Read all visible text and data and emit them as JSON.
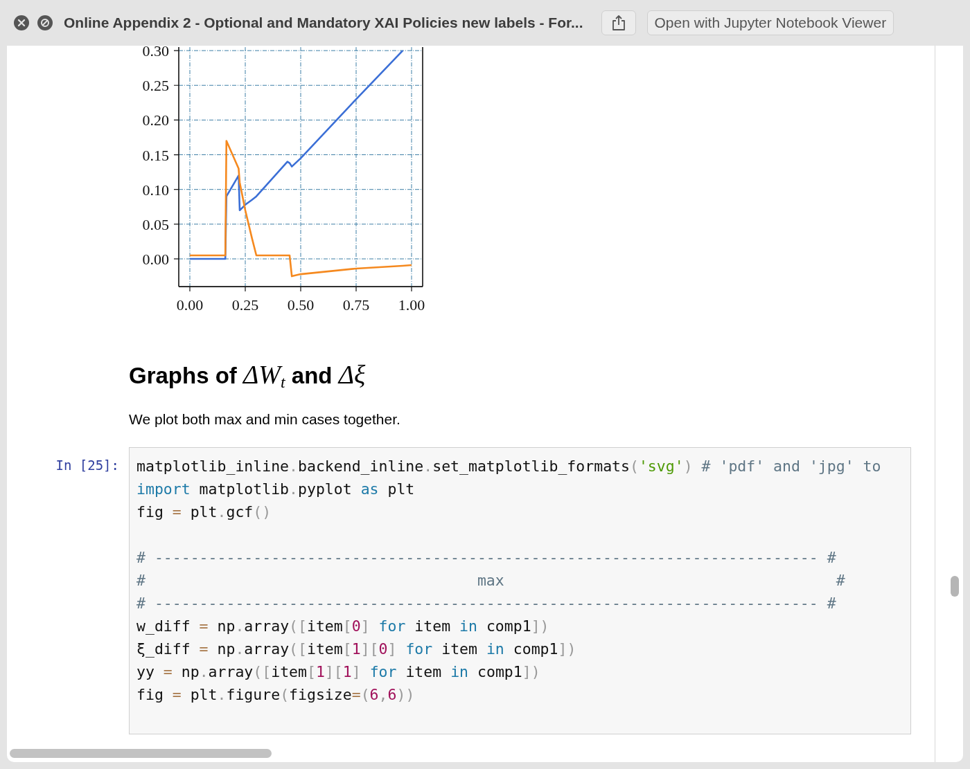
{
  "window": {
    "title": "Online Appendix 2 - Optional and Mandatory XAI Policies new labels - For...",
    "open_button": "Open with Jupyter Notebook Viewer"
  },
  "chart": {
    "chart_data": {
      "type": "line",
      "grid": true,
      "x": [
        0,
        0.16,
        0.165,
        0.22,
        0.225,
        0.25,
        0.28,
        0.3,
        0.44,
        0.45,
        0.46,
        0.5,
        0.75,
        0.96,
        1.0
      ],
      "series": [
        {
          "color": "#3b6fd6",
          "values": [
            0,
            0,
            0.09,
            0.12,
            0.07,
            0.078,
            0.085,
            0.09,
            0.14,
            0.138,
            0.133,
            0.145,
            0.23,
            0.3,
            null
          ]
        },
        {
          "color": "#f5891f",
          "values": [
            0.005,
            0.005,
            0.17,
            0.13,
            0.11,
            0.07,
            0.03,
            0.005,
            0.005,
            0.005,
            -0.025,
            -0.022,
            -0.014,
            -0.01,
            -0.009
          ]
        }
      ],
      "xlim": [
        -0.05,
        1.05
      ],
      "ylim": [
        -0.04,
        0.3
      ],
      "xticks": [
        {
          "value": 0,
          "label": "0.00"
        },
        {
          "value": 0.25,
          "label": "0.25"
        },
        {
          "value": 0.5,
          "label": "0.50"
        },
        {
          "value": 0.75,
          "label": "0.75"
        },
        {
          "value": 1,
          "label": "1.00"
        }
      ],
      "yticks": [
        {
          "value": 0,
          "label": "0.00"
        },
        {
          "value": 0.05,
          "label": "0.05"
        },
        {
          "value": 0.1,
          "label": "0.10"
        },
        {
          "value": 0.15,
          "label": "0.15"
        },
        {
          "value": 0.2,
          "label": "0.20"
        },
        {
          "value": 0.25,
          "label": "0.25"
        },
        {
          "value": 0.3,
          "label": "0.30"
        }
      ]
    }
  },
  "heading": [
    {
      "kind": "text",
      "text": "Graphs of "
    },
    {
      "kind": "math",
      "text": "ΔW"
    },
    {
      "kind": "sub",
      "text": "t"
    },
    {
      "kind": "text",
      "text": " and "
    },
    {
      "kind": "math",
      "text": "Δξ"
    }
  ],
  "paragraph": "We plot both max and min cases together.",
  "code_cell": {
    "prompt": "In [25]:",
    "lines": [
      {
        "kind": "code",
        "tokens": [
          {
            "kind": "name",
            "text": "matplotlib_inline"
          },
          {
            "kind": "punct",
            "text": "."
          },
          {
            "kind": "name",
            "text": "backend_inline"
          },
          {
            "kind": "punct",
            "text": "."
          },
          {
            "kind": "name",
            "text": "set_matplotlib_formats"
          },
          {
            "kind": "punct",
            "text": "("
          },
          {
            "kind": "string",
            "text": "'svg'"
          },
          {
            "kind": "punct",
            "text": ") "
          },
          {
            "kind": "comment",
            "text": "# 'pdf' and 'jpg' to"
          }
        ]
      },
      {
        "kind": "code",
        "tokens": [
          {
            "kind": "keyword",
            "text": "import"
          },
          {
            "kind": "name",
            "text": " matplotlib"
          },
          {
            "kind": "punct",
            "text": "."
          },
          {
            "kind": "name",
            "text": "pyplot "
          },
          {
            "kind": "keyword",
            "text": "as"
          },
          {
            "kind": "name",
            "text": " plt"
          }
        ]
      },
      {
        "kind": "code",
        "tokens": [
          {
            "kind": "name",
            "text": "fig "
          },
          {
            "kind": "operator",
            "text": "="
          },
          {
            "kind": "name",
            "text": " plt"
          },
          {
            "kind": "punct",
            "text": "."
          },
          {
            "kind": "name",
            "text": "gcf"
          },
          {
            "kind": "punct",
            "text": "()"
          }
        ]
      },
      {
        "kind": "blank"
      },
      {
        "kind": "code",
        "tokens": [
          {
            "kind": "comment",
            "text": "# -------------------------------------------------------------------------- #"
          }
        ]
      },
      {
        "kind": "code",
        "tokens": [
          {
            "kind": "comment",
            "text": "#                                     max                                     #"
          }
        ]
      },
      {
        "kind": "code",
        "tokens": [
          {
            "kind": "comment",
            "text": "# -------------------------------------------------------------------------- #"
          }
        ]
      },
      {
        "kind": "code",
        "tokens": [
          {
            "kind": "name",
            "text": "w_diff "
          },
          {
            "kind": "operator",
            "text": "="
          },
          {
            "kind": "name",
            "text": " np"
          },
          {
            "kind": "punct",
            "text": "."
          },
          {
            "kind": "name",
            "text": "array"
          },
          {
            "kind": "punct",
            "text": "(["
          },
          {
            "kind": "name",
            "text": "item"
          },
          {
            "kind": "punct",
            "text": "["
          },
          {
            "kind": "number",
            "text": "0"
          },
          {
            "kind": "punct",
            "text": "] "
          },
          {
            "kind": "keyword",
            "text": "for"
          },
          {
            "kind": "name",
            "text": " item "
          },
          {
            "kind": "keyword",
            "text": "in"
          },
          {
            "kind": "name",
            "text": " comp1"
          },
          {
            "kind": "punct",
            "text": "])"
          }
        ]
      },
      {
        "kind": "code",
        "tokens": [
          {
            "kind": "name",
            "text": "ξ_diff "
          },
          {
            "kind": "operator",
            "text": "="
          },
          {
            "kind": "name",
            "text": " np"
          },
          {
            "kind": "punct",
            "text": "."
          },
          {
            "kind": "name",
            "text": "array"
          },
          {
            "kind": "punct",
            "text": "(["
          },
          {
            "kind": "name",
            "text": "item"
          },
          {
            "kind": "punct",
            "text": "["
          },
          {
            "kind": "number",
            "text": "1"
          },
          {
            "kind": "punct",
            "text": "]["
          },
          {
            "kind": "number",
            "text": "0"
          },
          {
            "kind": "punct",
            "text": "] "
          },
          {
            "kind": "keyword",
            "text": "for"
          },
          {
            "kind": "name",
            "text": " item "
          },
          {
            "kind": "keyword",
            "text": "in"
          },
          {
            "kind": "name",
            "text": " comp1"
          },
          {
            "kind": "punct",
            "text": "])"
          }
        ]
      },
      {
        "kind": "code",
        "tokens": [
          {
            "kind": "name",
            "text": "yy "
          },
          {
            "kind": "operator",
            "text": "="
          },
          {
            "kind": "name",
            "text": " np"
          },
          {
            "kind": "punct",
            "text": "."
          },
          {
            "kind": "name",
            "text": "array"
          },
          {
            "kind": "punct",
            "text": "(["
          },
          {
            "kind": "name",
            "text": "item"
          },
          {
            "kind": "punct",
            "text": "["
          },
          {
            "kind": "number",
            "text": "1"
          },
          {
            "kind": "punct",
            "text": "]["
          },
          {
            "kind": "number",
            "text": "1"
          },
          {
            "kind": "punct",
            "text": "] "
          },
          {
            "kind": "keyword",
            "text": "for"
          },
          {
            "kind": "name",
            "text": " item "
          },
          {
            "kind": "keyword",
            "text": "in"
          },
          {
            "kind": "name",
            "text": " comp1"
          },
          {
            "kind": "punct",
            "text": "])"
          }
        ]
      },
      {
        "kind": "code",
        "tokens": [
          {
            "kind": "name",
            "text": "fig "
          },
          {
            "kind": "operator",
            "text": "="
          },
          {
            "kind": "name",
            "text": " plt"
          },
          {
            "kind": "punct",
            "text": "."
          },
          {
            "kind": "name",
            "text": "figure"
          },
          {
            "kind": "punct",
            "text": "("
          },
          {
            "kind": "name",
            "text": "figsize"
          },
          {
            "kind": "operator",
            "text": "="
          },
          {
            "kind": "punct",
            "text": "("
          },
          {
            "kind": "number",
            "text": "6"
          },
          {
            "kind": "punct",
            "text": ","
          },
          {
            "kind": "number",
            "text": "6"
          },
          {
            "kind": "punct",
            "text": "))"
          }
        ]
      }
    ]
  }
}
